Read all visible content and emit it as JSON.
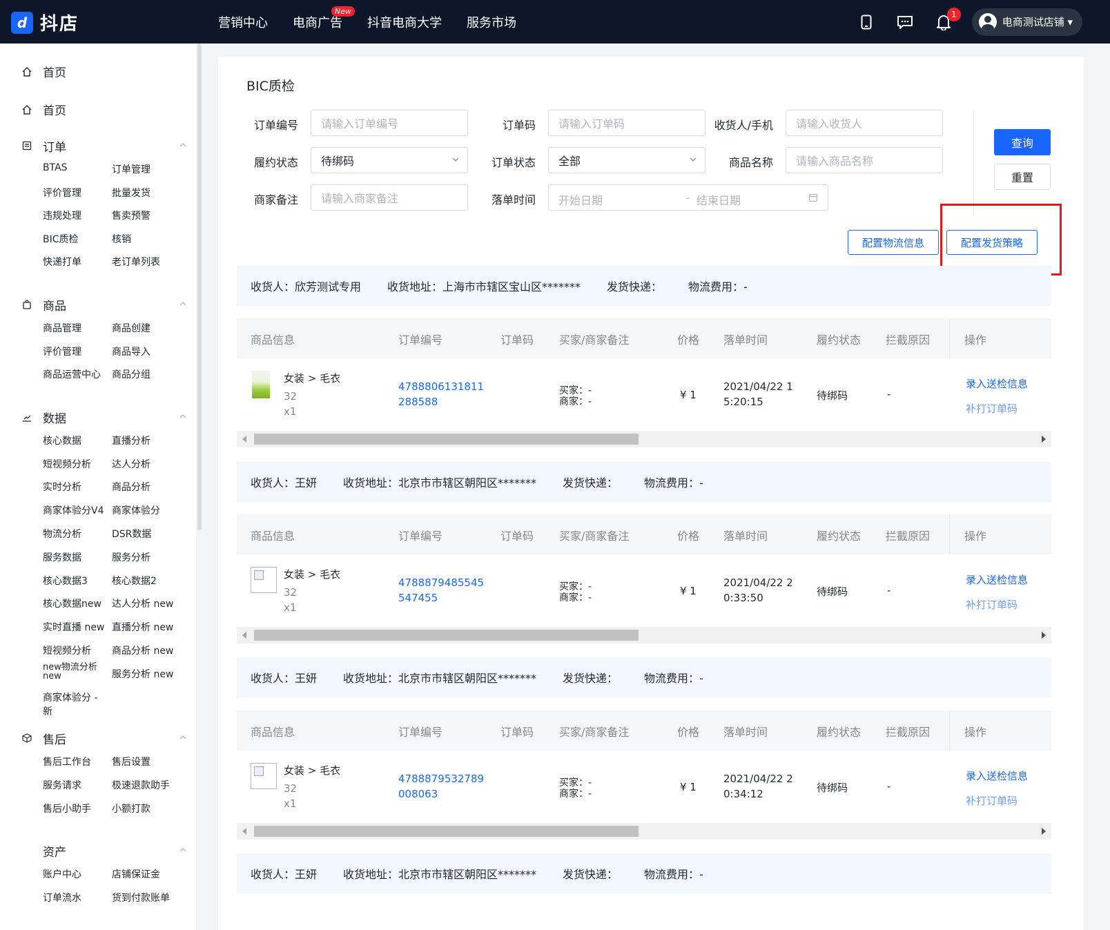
{
  "app": {
    "logo_mark": "d",
    "name": "抖店"
  },
  "topnav": [
    {
      "label": "营销中心"
    },
    {
      "label": "电商广告",
      "badge": "New"
    },
    {
      "label": "抖音电商大学"
    },
    {
      "label": "服务市场"
    }
  ],
  "topright": {
    "bell_count": "1",
    "store_name": "电商测试店铺 ▾"
  },
  "sidebar": {
    "home1": "首页",
    "home2": "首页",
    "order": {
      "title": "订单",
      "links": [
        "BTAS",
        "订单管理",
        "评价管理",
        "批量发货",
        "违规处理",
        "售卖预警",
        "BIC质检",
        "核销",
        "快递打单",
        "老订单列表"
      ]
    },
    "product": {
      "title": "商品",
      "links": [
        "商品管理",
        "商品创建",
        "评价管理",
        "商品导入",
        "商品运营中心",
        "商品分组"
      ]
    },
    "data": {
      "title": "数据",
      "links": [
        "核心数据",
        "直播分析",
        "短视频分析",
        "达人分析",
        "实时分析",
        "商品分析",
        "商家体验分V4",
        "商家体验分",
        "物流分析",
        "DSR数据",
        "服务数据",
        "服务分析",
        "核心数据3",
        "核心数据2",
        "核心数据new",
        "达人分析 new",
        "实时直播 new",
        "直播分析 new",
        "短视频分析",
        "商品分析 new",
        "new物流分析 new",
        "服务分析 new",
        "商家体验分 -",
        "新"
      ]
    },
    "aftersale": {
      "title": "售后",
      "links": [
        "售后工作台",
        "售后设置",
        "服务请求",
        "极速退款助手",
        "售后小助手",
        "小额打款"
      ]
    },
    "assets": {
      "title": "资产",
      "links": [
        "账户中心",
        "店铺保证金",
        "订单流水",
        "货到付款账单"
      ]
    }
  },
  "page": {
    "title": "BIC质检",
    "filters": {
      "order_no": {
        "label": "订单编号",
        "placeholder": "请输入订单编号"
      },
      "order_code": {
        "label": "订单码",
        "placeholder": "请输入订单码"
      },
      "receiver": {
        "label": "收货人/手机",
        "placeholder": "请输入收货人"
      },
      "fulfill_status": {
        "label": "履约状态",
        "value": "待绑码"
      },
      "order_status": {
        "label": "订单状态",
        "value": "全部"
      },
      "product_name": {
        "label": "商品名称",
        "placeholder": "请输入商品名称"
      },
      "merchant_note": {
        "label": "商家备注",
        "placeholder": "请输入商家备注"
      },
      "order_time": {
        "label": "落单时间",
        "start": "开始日期",
        "sep": "-",
        "end": "结束日期"
      }
    },
    "buttons": {
      "query": "查询",
      "reset": "重置",
      "config_logistics": "配置物流信息",
      "config_ship": "配置发货策略"
    },
    "columns": [
      "商品信息",
      "订单编号",
      "订单码",
      "买家/商家备注",
      "价格",
      "落单时间",
      "履约状态",
      "拦截原因",
      "操作"
    ],
    "groups": [
      {
        "receiver": "收货人：欣芳测试专用",
        "address": "收货地址：上海市市辖区宝山区*******",
        "express": "发货快递：",
        "fee": "物流费用：-",
        "row": {
          "category": "女装 > 毛衣",
          "qty_code": "32",
          "qty": "x1",
          "order_no_1": "4788806131811",
          "order_no_2": "288588",
          "buyer": "买家：-",
          "merchant": "商家：-",
          "price": "¥ 1",
          "time_1": "2021/04/22 1",
          "time_2": "5:20:15",
          "status": "待绑码",
          "reason": "-",
          "op1": "录入送检信息",
          "op2": "补打订单码"
        }
      },
      {
        "receiver": "收货人：王妍",
        "address": "收货地址：北京市市辖区朝阳区*******",
        "express": "发货快递：",
        "fee": "物流费用：-",
        "row": {
          "category": "女装 > 毛衣",
          "qty_code": "32",
          "qty": "x1",
          "order_no_1": "4788879485545",
          "order_no_2": "547455",
          "buyer": "买家：-",
          "merchant": "商家：-",
          "price": "¥ 1",
          "time_1": "2021/04/22 2",
          "time_2": "0:33:50",
          "status": "待绑码",
          "reason": "-",
          "op1": "录入送检信息",
          "op2": "补打订单码"
        }
      },
      {
        "receiver": "收货人：王妍",
        "address": "收货地址：北京市市辖区朝阳区*******",
        "express": "发货快递：",
        "fee": "物流费用：-",
        "row": {
          "category": "女装 > 毛衣",
          "qty_code": "32",
          "qty": "x1",
          "order_no_1": "4788879532789",
          "order_no_2": "008063",
          "buyer": "买家：-",
          "merchant": "商家：-",
          "price": "¥ 1",
          "time_1": "2021/04/22 2",
          "time_2": "0:34:12",
          "status": "待绑码",
          "reason": "-",
          "op1": "录入送检信息",
          "op2": "补打订单码"
        }
      },
      {
        "receiver": "收货人：王妍",
        "address": "收货地址：北京市市辖区朝阳区*******",
        "express": "发货快递：",
        "fee": "物流费用：-"
      }
    ]
  },
  "colors": {
    "topbar": "#0d1729",
    "primary": "#1966ff",
    "highlight": "#e8141e",
    "ship_bar": "#f1f6ff"
  }
}
